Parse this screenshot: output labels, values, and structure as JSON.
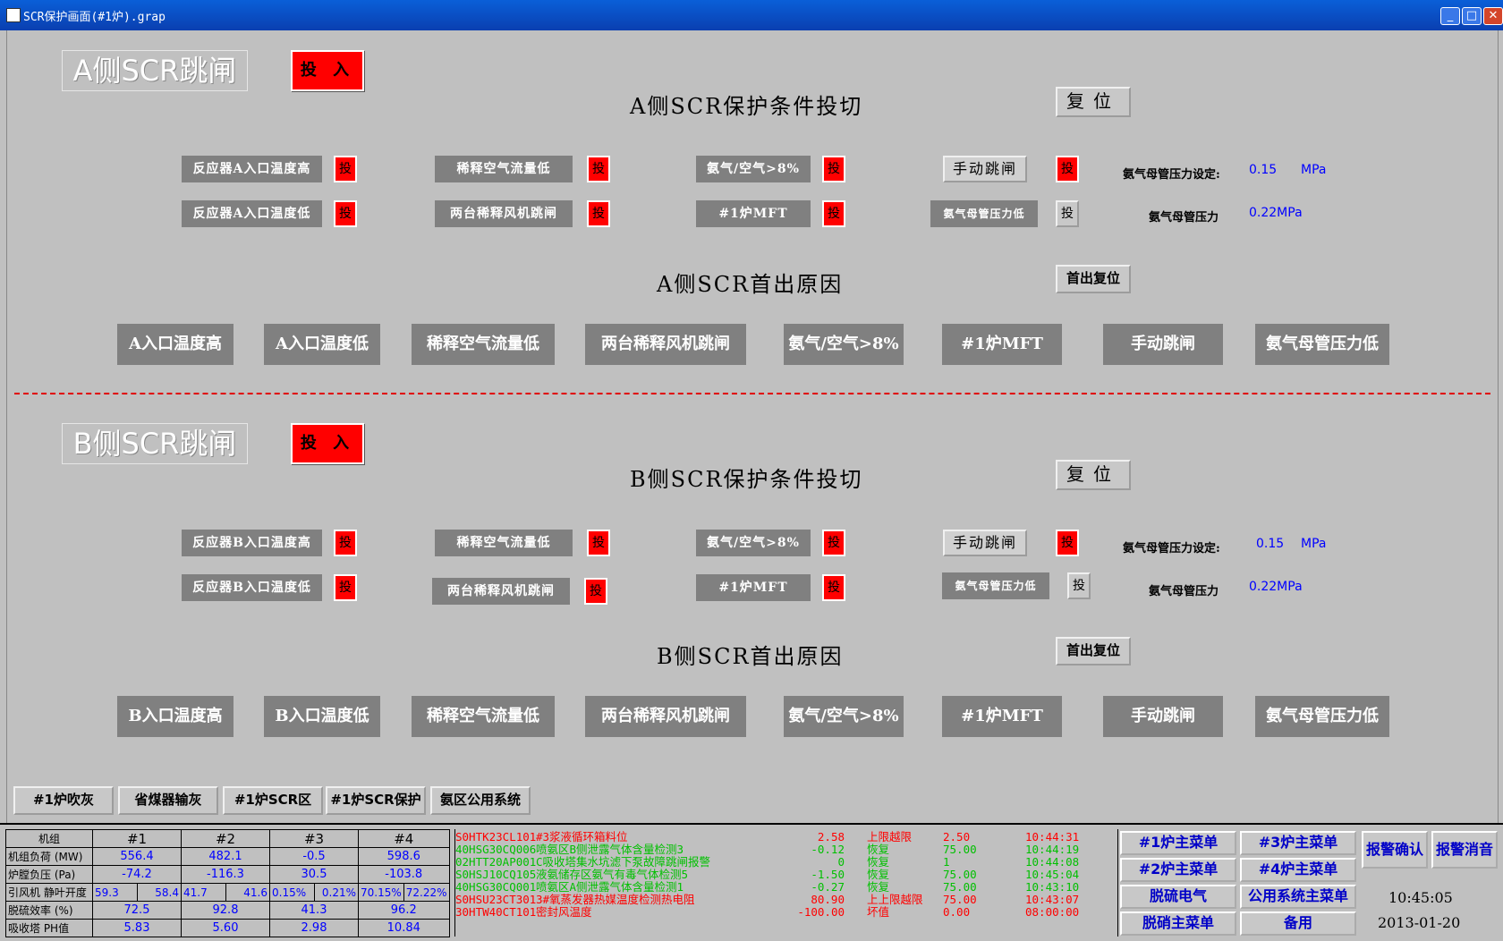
{
  "window": {
    "title": "SCR保护画面(#1炉).grap"
  },
  "sideA": {
    "title": "A侧SCR跳闸",
    "enable": "投 入",
    "cond_title": "A侧SCR保护条件投切",
    "reset": "复位",
    "conds": [
      {
        "label": "反应器A入口温度高",
        "tog": "投"
      },
      {
        "label": "稀释空气流量低",
        "tog": "投"
      },
      {
        "label": "氨气/空气>8%",
        "tog": "投"
      },
      {
        "label": "手动跳闸",
        "tog": "投"
      },
      {
        "label": "反应器A入口温度低",
        "tog": "投"
      },
      {
        "label": "两台稀释风机跳闸",
        "tog": "投"
      },
      {
        "label": "#1炉MFT",
        "tog": "投"
      },
      {
        "label": "氨气母管压力低",
        "tog": "投"
      }
    ],
    "p_set_label": "氨气母管压力设定:",
    "p_set_value": "0.15",
    "p_set_unit": "MPa",
    "p_label": "氨气母管压力",
    "p_value": "0.22MPa",
    "first_title": "A侧SCR首出原因",
    "first_reset": "首出复位",
    "firsts": [
      "A入口温度高",
      "A入口温度低",
      "稀释空气流量低",
      "两台稀释风机跳闸",
      "氨气/空气>8%",
      "#1炉MFT",
      "手动跳闸",
      "氨气母管压力低"
    ]
  },
  "sideB": {
    "title": "B侧SCR跳闸",
    "enable": "投 入",
    "cond_title": "B侧SCR保护条件投切",
    "reset": "复位",
    "conds": [
      {
        "label": "反应器B入口温度高",
        "tog": "投"
      },
      {
        "label": "稀释空气流量低",
        "tog": "投"
      },
      {
        "label": "氨气/空气>8%",
        "tog": "投"
      },
      {
        "label": "手动跳闸",
        "tog": "投"
      },
      {
        "label": "反应器B入口温度低",
        "tog": "投"
      },
      {
        "label": "两台稀释风机跳闸",
        "tog": "投"
      },
      {
        "label": "#1炉MFT",
        "tog": "投"
      },
      {
        "label": "氨气母管压力低",
        "tog": "投"
      }
    ],
    "p_set_label": "氨气母管压力设定:",
    "p_set_value": "0.15",
    "p_set_unit": "MPa",
    "p_label": "氨气母管压力",
    "p_value": "0.22MPa",
    "first_title": "B侧SCR首出原因",
    "first_reset": "首出复位",
    "firsts": [
      "B入口温度高",
      "B入口温度低",
      "稀释空气流量低",
      "两台稀释风机跳闸",
      "氨气/空气>8%",
      "#1炉MFT",
      "手动跳闸",
      "氨气母管压力低"
    ]
  },
  "nav": [
    "#1炉吹灰",
    "省煤器输灰",
    "#1炉SCR区",
    "#1炉SCR保护",
    "氨区公用系统"
  ],
  "table": {
    "header": [
      "机组",
      "#1",
      "#2",
      "#3",
      "#4"
    ],
    "rows": [
      {
        "label": "机组负荷 (MW)",
        "vals": [
          "556.4",
          "482.1",
          "-0.5",
          "598.6"
        ]
      },
      {
        "label": "炉膛负压 (Pa)",
        "vals": [
          "-74.2",
          "-116.3",
          "30.5",
          "-103.8"
        ]
      },
      {
        "label": "引风机 静叶开度",
        "pairs": [
          [
            "59.3",
            "58.4"
          ],
          [
            "41.7",
            "41.6"
          ],
          [
            "0.15%",
            "0.21%"
          ],
          [
            "70.15%",
            "72.22%"
          ]
        ]
      },
      {
        "label": "脱硫效率 (%)",
        "vals": [
          "72.5",
          "92.8",
          "41.3",
          "96.2"
        ]
      },
      {
        "label": "吸收塔 PH值",
        "vals": [
          "5.83",
          "5.60",
          "2.98",
          "10.84"
        ]
      }
    ]
  },
  "alarms": [
    {
      "tag": "S0HTK23CL101",
      "desc": "#3浆液循环箱料位",
      "val": "2.58",
      "status": "上限越限",
      "limit": "2.50",
      "time": "10:44:31",
      "color": "#ff0000"
    },
    {
      "tag": "40HSG30CQ006",
      "desc": "喷氨区B侧泄露气体含量检测3",
      "val": "-0.12",
      "status": "恢复",
      "limit": "75.00",
      "time": "10:44:19",
      "color": "#00c000"
    },
    {
      "tag": "02HTT20AP001",
      "desc": "C吸收塔集水坑滤下泵故障跳闸报警",
      "val": "0",
      "status": "恢复",
      "limit": "1",
      "time": "10:44:08",
      "color": "#00c000"
    },
    {
      "tag": "S0HSJ10CQ105",
      "desc": "液氨储存区氨气有毒气体检测5",
      "val": "-1.50",
      "status": "恢复",
      "limit": "75.00",
      "time": "10:45:04",
      "color": "#00c000"
    },
    {
      "tag": "40HSG30CQ001",
      "desc": "喷氨区A侧泄露气体含量检测1",
      "val": "-0.27",
      "status": "恢复",
      "limit": "75.00",
      "time": "10:43:10",
      "color": "#00c000"
    },
    {
      "tag": "S0HSU23CT301",
      "desc": "3#氧蒸发器热媒温度检测热电阻",
      "val": "80.90",
      "status": "上上限越限",
      "limit": "75.00",
      "time": "10:43:07",
      "color": "#ff0000"
    },
    {
      "tag": "30HTW40CT101",
      "desc": "密封风温度",
      "val": "-100.00",
      "status": "坏值",
      "limit": "0.00",
      "time": "08:00:00",
      "color": "#ff0000"
    }
  ],
  "menus": [
    "#1炉主菜单",
    "#3炉主菜单",
    "#2炉主菜单",
    "#4炉主菜单",
    "脱硫电气",
    "公用系统主菜单",
    "脱硝主菜单",
    "备用"
  ],
  "ack": [
    "报警确认",
    "报警消音"
  ],
  "clock": {
    "time": "10:45:05",
    "date": "2013-01-20"
  }
}
